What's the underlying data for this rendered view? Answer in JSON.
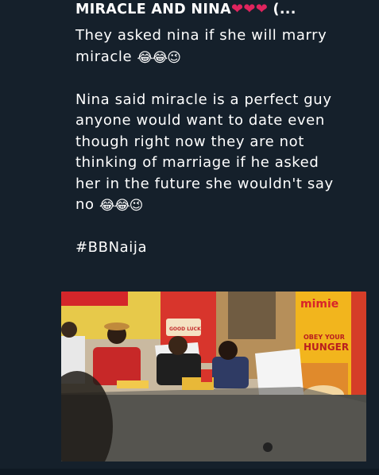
{
  "tweet": {
    "title": "MIRACLE AND NINA",
    "title_hearts": "❤❤❤",
    "title_suffix": "(...",
    "lines": [
      {
        "text": "They asked nina if she will marry",
        "emoji": ""
      },
      {
        "text": "miracle ",
        "emoji": "😂😂😉"
      },
      {
        "text": "",
        "emoji": ""
      },
      {
        "text": "Nina said miracle is a perfect guy",
        "emoji": ""
      },
      {
        "text": "anyone would want to date even",
        "emoji": ""
      },
      {
        "text": "though right now they are not",
        "emoji": ""
      },
      {
        "text": "thinking of marriage if he asked",
        "emoji": ""
      },
      {
        "text": "her in the future she wouldn't say",
        "emoji": ""
      },
      {
        "text": "no ",
        "emoji": "😂😂😉"
      },
      {
        "text": "",
        "emoji": ""
      },
      {
        "text": "#BBNaija",
        "emoji": ""
      }
    ],
    "photo": {
      "sign_brand": "mimie",
      "sign_line1": "OBEY YOUR",
      "sign_line2": "HUNGER",
      "good_luck": "GOOD LUCK"
    }
  },
  "colors": {
    "background": "#15202b",
    "text": "#ffffff",
    "heart": "#e0245e"
  }
}
